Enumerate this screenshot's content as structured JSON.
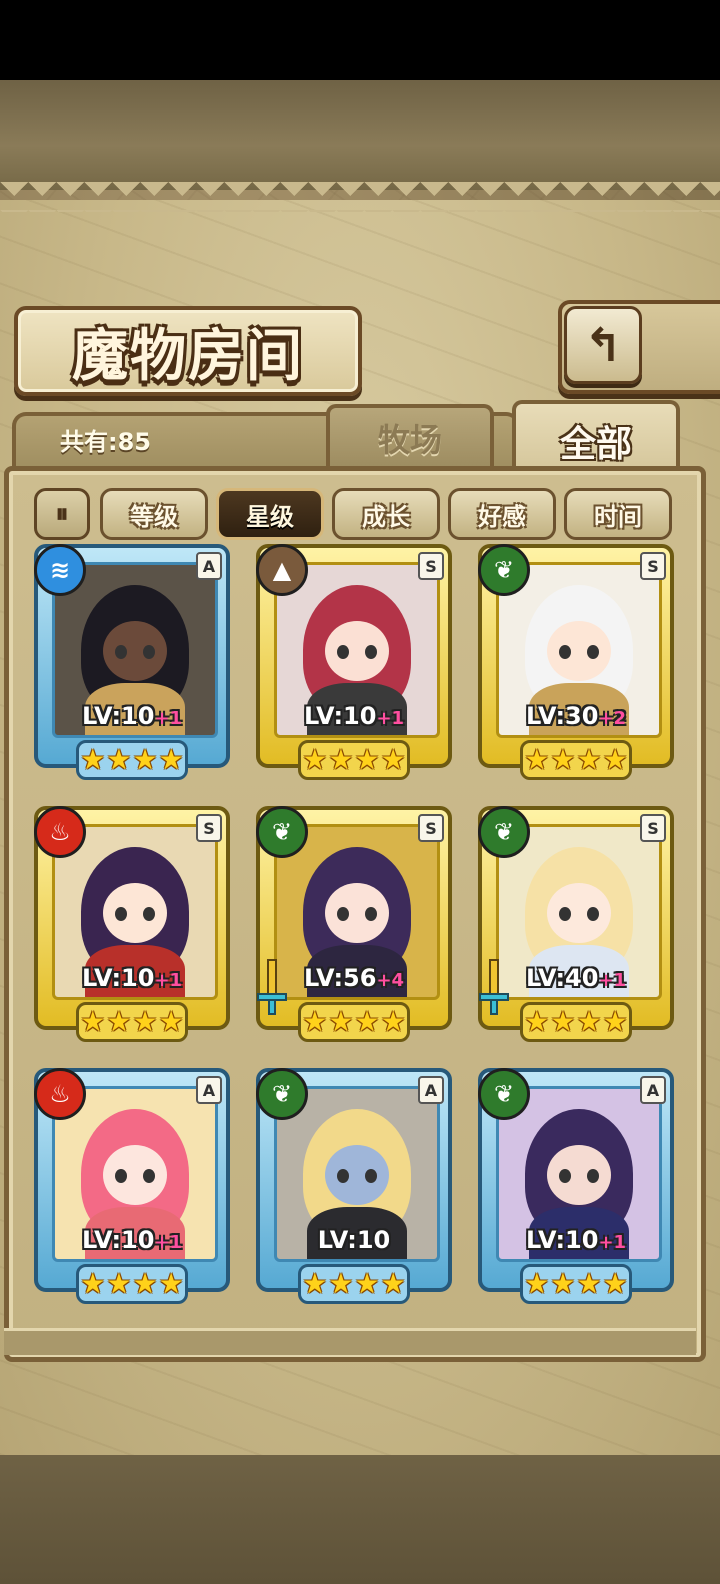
{
  "title": "魔物房间",
  "back_icon": "return-arrow-icon",
  "count_label": "共有:85",
  "tabs": {
    "ranch": "牧场",
    "all": "全部",
    "active": "all"
  },
  "sort": {
    "toggle_icon": "sort-order-icon",
    "buttons": [
      "等级",
      "星级",
      "成长",
      "好感",
      "时间"
    ],
    "active": "星级"
  },
  "monsters": [
    {
      "rank": "A",
      "element": "water",
      "level": "LV:10",
      "bonus": "+1",
      "stars": 4,
      "colors": {
        "bg": "#5b5348",
        "hair": "#1c1a22",
        "face": "#6b4a3a",
        "body": "#caa35c"
      }
    },
    {
      "rank": "S",
      "element": "earth",
      "level": "LV:10",
      "bonus": "+1",
      "stars": 4,
      "colors": {
        "bg": "#e6d7d6",
        "hair": "#b33448",
        "face": "#fbe0d4",
        "body": "#3a3a3a"
      }
    },
    {
      "rank": "S",
      "element": "nature",
      "level": "LV:30",
      "bonus": "+2",
      "stars": 4,
      "colors": {
        "bg": "#f3efe6",
        "hair": "#f4f4f4",
        "face": "#fde6d6",
        "body": "#c9a35a"
      }
    },
    {
      "rank": "S",
      "element": "fire",
      "level": "LV:10",
      "bonus": "+1",
      "stars": 4,
      "colors": {
        "bg": "#e9d9b3",
        "hair": "#3a2550",
        "face": "#fde6d6",
        "body": "#b8302a"
      }
    },
    {
      "rank": "S",
      "element": "nature",
      "level": "LV:56",
      "bonus": "+4",
      "stars": 4,
      "colors": {
        "bg": "#d8b44a",
        "hair": "#3d2b5a",
        "face": "#fbe2d8",
        "body": "#2d2640"
      },
      "weapon": true
    },
    {
      "rank": "S",
      "element": "nature",
      "level": "LV:40",
      "bonus": "+1",
      "stars": 4,
      "colors": {
        "bg": "#f0e8c8",
        "hair": "#f6e1a6",
        "face": "#fde9dc",
        "body": "#dde6f2"
      },
      "weapon": true
    },
    {
      "rank": "A",
      "element": "fire",
      "level": "LV:10",
      "bonus": "+1",
      "stars": 4,
      "colors": {
        "bg": "#f6e3b0",
        "hair": "#f36a86",
        "face": "#fde6de",
        "body": "#e86a74"
      }
    },
    {
      "rank": "A",
      "element": "nature",
      "level": "LV:10",
      "bonus": "",
      "stars": 4,
      "colors": {
        "bg": "#b8b2a6",
        "hair": "#f2d98a",
        "face": "#9fb6d9",
        "body": "#2b2b2f"
      }
    },
    {
      "rank": "A",
      "element": "nature",
      "level": "LV:10",
      "bonus": "+1",
      "stars": 4,
      "colors": {
        "bg": "#d4c2e4",
        "hair": "#3a2a5e",
        "face": "#f5dbd2",
        "body": "#2c2e6a"
      }
    }
  ]
}
